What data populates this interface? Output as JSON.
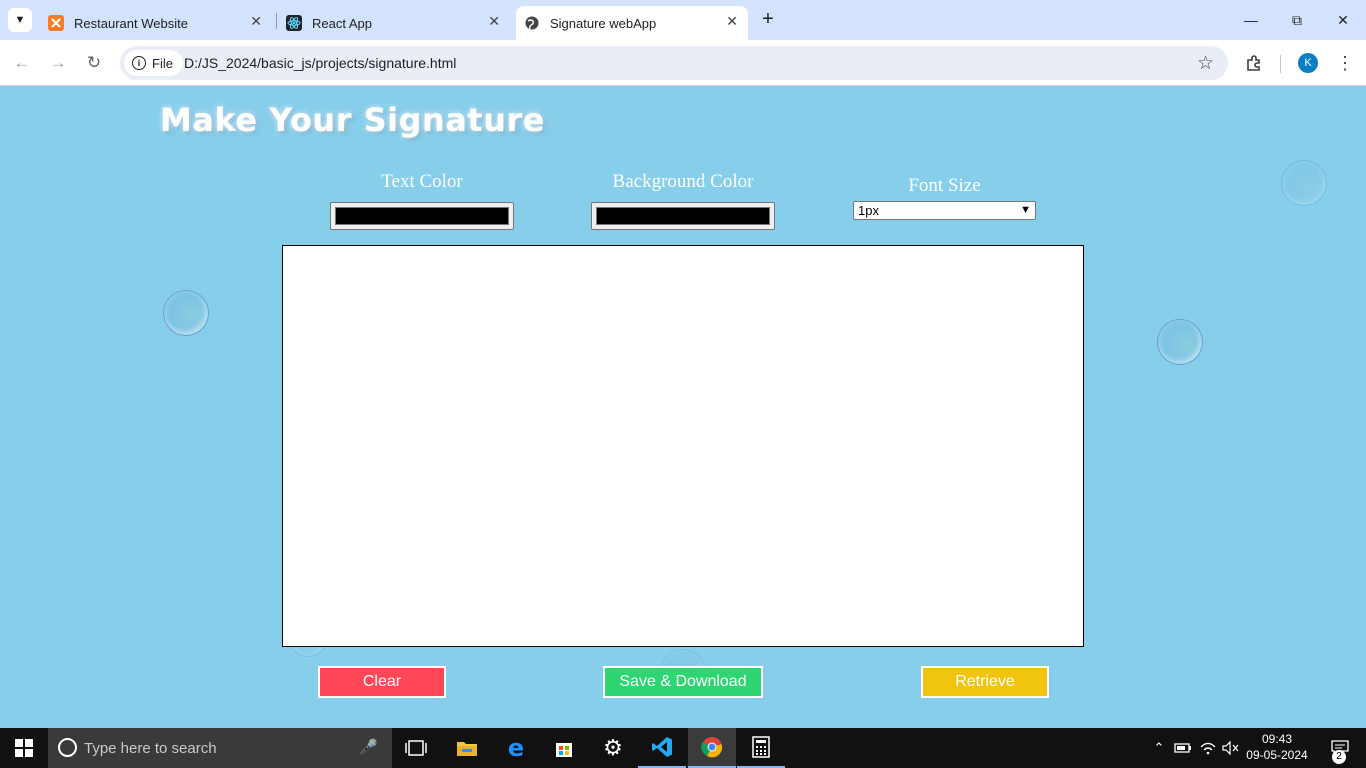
{
  "browser": {
    "tabs": [
      {
        "title": "Restaurant Website",
        "icon": "xampp-icon",
        "active": false
      },
      {
        "title": "React App",
        "icon": "react-icon",
        "active": false
      },
      {
        "title": "Signature webApp",
        "icon": "globe-icon",
        "active": true
      }
    ],
    "site_chip": "File",
    "url": "D:/JS_2024/basic_js/projects/signature.html",
    "profile_initial": "K"
  },
  "page": {
    "title": "Make Your Signature",
    "controls": {
      "text_color_label": "Text Color",
      "text_color_value": "#000000",
      "background_color_label": "Background Color",
      "background_color_value": "#000000",
      "font_size_label": "Font Size",
      "font_size_selected": "1px"
    },
    "buttons": {
      "clear": "Clear",
      "save": "Save & Download",
      "retrieve": "Retrieve"
    },
    "colors": {
      "background": "#87ceeb",
      "clear_button": "#ff4757",
      "save_button": "#2ed573",
      "retrieve_button": "#f1c40f",
      "canvas": "#ffffff"
    }
  },
  "taskbar": {
    "search_placeholder": "Type here to search",
    "time": "09:43",
    "date": "09-05-2024",
    "notification_count": "2"
  }
}
